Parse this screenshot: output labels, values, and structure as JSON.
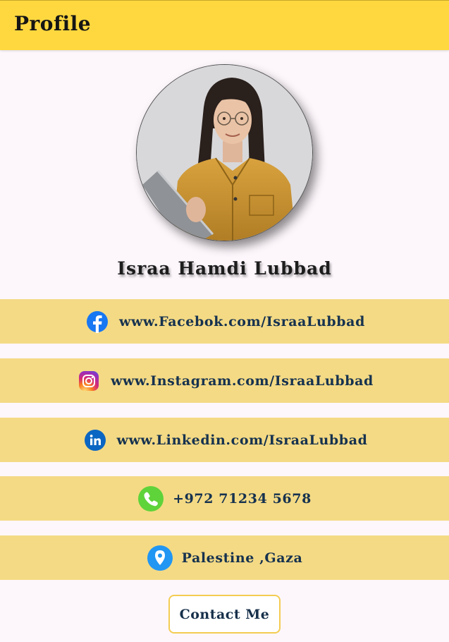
{
  "header": {
    "title": "Profile"
  },
  "profile": {
    "name": "Israa Hamdi Lubbad",
    "avatar_icon": "profile-photo"
  },
  "contacts": [
    {
      "icon": "facebook-icon",
      "text": "www.Facebok.com/IsraaLubbad",
      "color": "#1877f2"
    },
    {
      "icon": "instagram-icon",
      "text": "www.Instagram.com/IsraaLubbad",
      "color": "#d62976"
    },
    {
      "icon": "linkedin-icon",
      "text": "www.Linkedin.com/IsraaLubbad",
      "color": "#0a66c2"
    },
    {
      "icon": "phone-icon",
      "text": "+972 71234 5678",
      "color": "#4cd137"
    },
    {
      "icon": "location-icon",
      "text": "Palestine ,Gaza",
      "color": "#1e90ff"
    }
  ],
  "actions": {
    "contact_label": "Contact Me"
  },
  "colors": {
    "appbar": "#ffd83f",
    "row_background": "#f4da85",
    "page_background": "#fdf7fc",
    "text_dark_blue": "#16324f"
  }
}
